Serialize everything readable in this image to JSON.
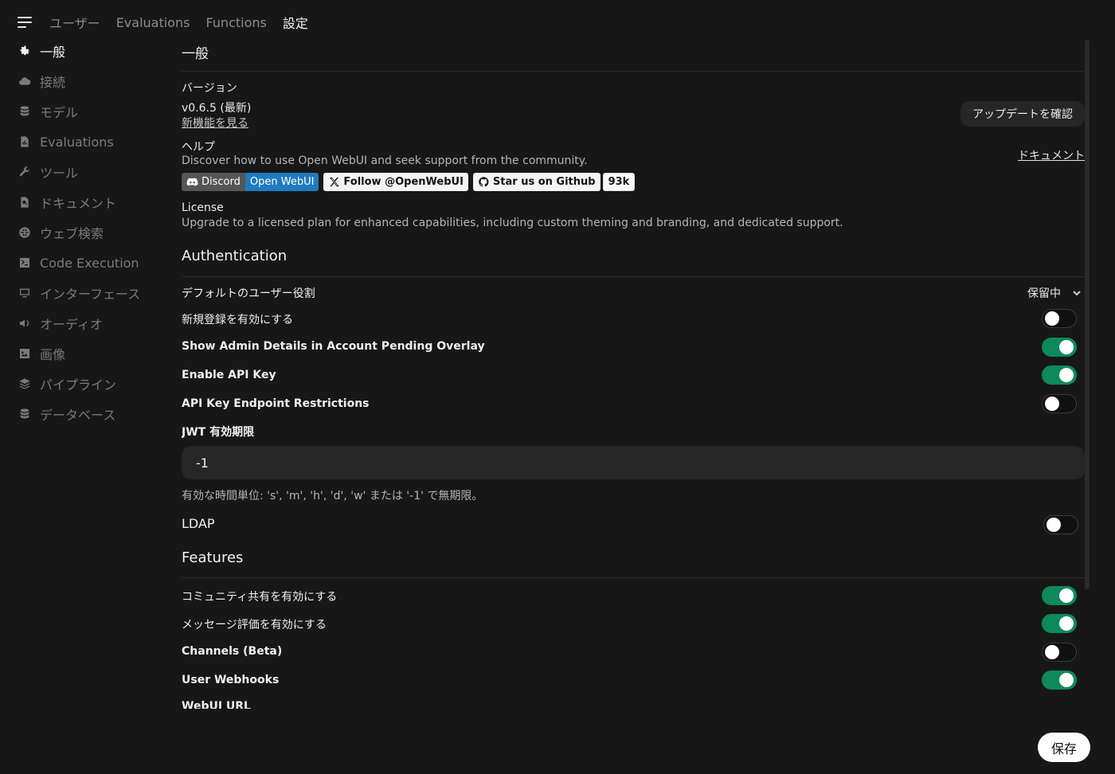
{
  "topnav": {
    "tabs": [
      "ユーザー",
      "Evaluations",
      "Functions",
      "設定"
    ],
    "active_index": 3
  },
  "sidebar": {
    "items": [
      {
        "label": "一般",
        "icon": "gear-icon"
      },
      {
        "label": "接続",
        "icon": "cloud-icon"
      },
      {
        "label": "モデル",
        "icon": "database-icon"
      },
      {
        "label": "Evaluations",
        "icon": "document-chart-icon"
      },
      {
        "label": "ツール",
        "icon": "wrench-icon"
      },
      {
        "label": "ドキュメント",
        "icon": "document-search-icon"
      },
      {
        "label": "ウェブ検索",
        "icon": "globe-icon"
      },
      {
        "label": "Code Execution",
        "icon": "terminal-icon"
      },
      {
        "label": "インターフェース",
        "icon": "monitor-icon"
      },
      {
        "label": "オーディオ",
        "icon": "speaker-icon"
      },
      {
        "label": "画像",
        "icon": "image-icon"
      },
      {
        "label": "パイプライン",
        "icon": "layers-icon"
      },
      {
        "label": "データベース",
        "icon": "database-icon"
      }
    ],
    "active_index": 0
  },
  "general": {
    "title": "一般",
    "version_label": "バージョン",
    "version_value": "v0.6.5 (最新)",
    "whats_new_link": "新機能を見る",
    "check_update_button": "アップデートを確認",
    "help_label": "ヘルプ",
    "help_text": "Discover how to use Open WebUI and seek support from the community.",
    "documents_link": "ドキュメント",
    "badges": {
      "discord_left": "Discord",
      "discord_right": "Open WebUI",
      "x_follow": "Follow @OpenWebUI",
      "github_star": "Star us on Github",
      "github_count": "93k"
    },
    "license_label": "License",
    "license_text": "Upgrade to a licensed plan for enhanced capabilities, including custom theming and branding, and dedicated support."
  },
  "authentication": {
    "title": "Authentication",
    "default_role_label": "デフォルトのユーザー役割",
    "default_role_value": "保留中",
    "signup_label": "新規登録を有効にする",
    "signup_enabled": false,
    "admin_details_label": "Show Admin Details in Account Pending Overlay",
    "admin_details_enabled": true,
    "api_key_label": "Enable API Key",
    "api_key_enabled": true,
    "api_restrictions_label": "API Key Endpoint Restrictions",
    "api_restrictions_enabled": false,
    "jwt_label": "JWT 有効期限",
    "jwt_value": "-1",
    "jwt_hint": "有効な時間単位: 's', 'm', 'h', 'd', 'w' または '-1' で無期限。",
    "ldap_label": "LDAP",
    "ldap_enabled": false
  },
  "features": {
    "title": "Features",
    "community_label": "コミュニティ共有を有効にする",
    "community_enabled": true,
    "rating_label": "メッセージ評価を有効にする",
    "rating_enabled": true,
    "channels_label": "Channels (Beta)",
    "channels_enabled": false,
    "webhooks_label": "User Webhooks",
    "webhooks_enabled": true,
    "webui_url_label": "WebUI URL"
  },
  "save_button": "保存",
  "colors": {
    "background": "#171717",
    "toggle_on": "#0c8a5a",
    "discord_badge": "#1f7abf"
  }
}
